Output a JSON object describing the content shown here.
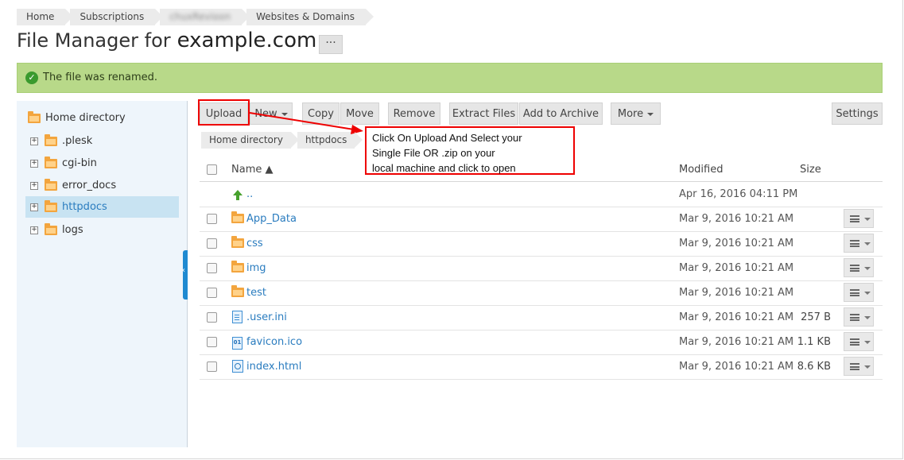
{
  "breadcrumbs": [
    "Home",
    "Subscriptions",
    "chuxRevioon",
    "Websites & Domains"
  ],
  "title": {
    "prefix": "File Manager for",
    "domain": "example.com"
  },
  "title_menu_label": "···",
  "alert": {
    "text": "The file was renamed.",
    "color": "#b8d989"
  },
  "tree": {
    "root": "Home directory",
    "items": [
      {
        "label": ".plesk"
      },
      {
        "label": "cgi-bin"
      },
      {
        "label": "error_docs"
      },
      {
        "label": "httpdocs",
        "selected": true
      },
      {
        "label": "logs"
      }
    ]
  },
  "toolbar": {
    "upload": "Upload",
    "new": "New",
    "copy": "Copy",
    "move": "Move",
    "remove": "Remove",
    "extract": "Extract Files",
    "add_archive": "Add to Archive",
    "more": "More",
    "settings": "Settings"
  },
  "path": [
    "Home directory",
    "httpdocs"
  ],
  "annotation": {
    "line1": "Click On Upload And Select your",
    "line2": "Single File OR .zip on your",
    "line3": "local machine and click to open"
  },
  "table": {
    "headers": {
      "name": "Name ▲",
      "modified": "Modified",
      "size": "Size"
    },
    "rows": [
      {
        "name": "..",
        "modified": "Apr 16, 2016 04:11 PM",
        "size": "",
        "type": "parent"
      },
      {
        "name": "App_Data",
        "modified": "Mar 9, 2016 10:21 AM",
        "size": "",
        "type": "folder"
      },
      {
        "name": "css",
        "modified": "Mar 9, 2016 10:21 AM",
        "size": "",
        "type": "folder"
      },
      {
        "name": "img",
        "modified": "Mar 9, 2016 10:21 AM",
        "size": "",
        "type": "folder"
      },
      {
        "name": "test",
        "modified": "Mar 9, 2016 10:21 AM",
        "size": "",
        "type": "folder"
      },
      {
        "name": ".user.ini",
        "modified": "Mar 9, 2016 10:21 AM",
        "size": "257 B",
        "type": "file"
      },
      {
        "name": "favicon.ico",
        "modified": "Mar 9, 2016 10:21 AM",
        "size": "1.1 KB",
        "type": "binary"
      },
      {
        "name": "index.html",
        "modified": "Mar 9, 2016 10:21 AM",
        "size": "8.6 KB",
        "type": "html"
      }
    ]
  }
}
